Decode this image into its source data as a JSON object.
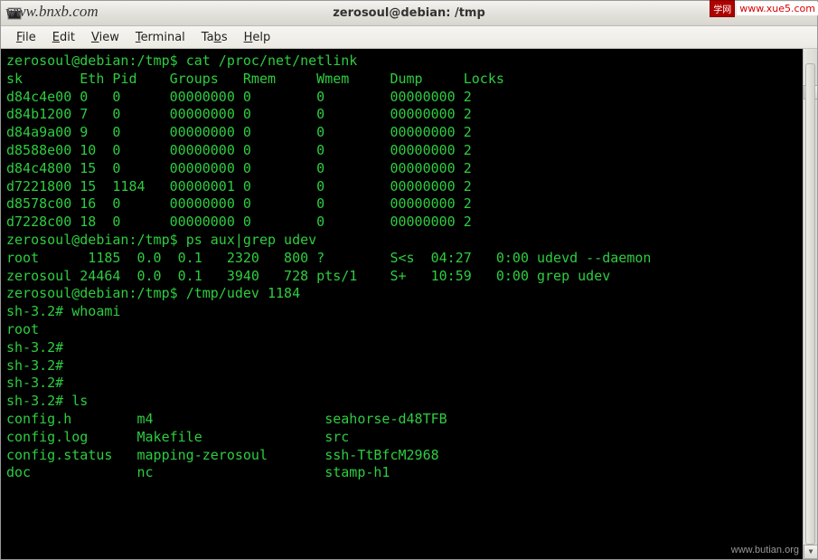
{
  "watermarks": {
    "top_left": "www.bnxb.com",
    "top_right_badge": "学网",
    "top_right_text": "www.xue5.com",
    "bottom_right": "www.butian.org"
  },
  "window": {
    "title": "zerosoul@debian: /tmp"
  },
  "menubar": {
    "file": "File",
    "edit": "Edit",
    "view": "View",
    "terminal": "Terminal",
    "tabs": "Tabs",
    "help": "Help"
  },
  "terminal": {
    "prompt1": "zerosoul@debian:/tmp$ ",
    "cmd1": "cat /proc/net/netlink",
    "netlink_header": "sk       Eth Pid    Groups   Rmem     Wmem     Dump     Locks",
    "netlink_rows": [
      "d84c4e00 0   0      00000000 0        0        00000000 2",
      "d84b1200 7   0      00000000 0        0        00000000 2",
      "d84a9a00 9   0      00000000 0        0        00000000 2",
      "d8588e00 10  0      00000000 0        0        00000000 2",
      "d84c4800 15  0      00000000 0        0        00000000 2",
      "d7221800 15  1184   00000001 0        0        00000000 2",
      "d8578c00 16  0      00000000 0        0        00000000 2",
      "d7228c00 18  0      00000000 0        0        00000000 2"
    ],
    "prompt2": "zerosoul@debian:/tmp$ ",
    "cmd2": "ps aux|grep udev",
    "ps_rows": [
      "root      1185  0.0  0.1   2320   800 ?        S<s  04:27   0:00 udevd --daemon",
      "zerosoul 24464  0.0  0.1   3940   728 pts/1    S+   10:59   0:00 grep udev"
    ],
    "prompt3": "zerosoul@debian:/tmp$ ",
    "cmd3": "/tmp/udev 1184",
    "sh_lines": [
      "sh-3.2# whoami",
      "root",
      "sh-3.2#",
      "sh-3.2#",
      "sh-3.2#",
      "sh-3.2# ls"
    ],
    "ls_rows": [
      "config.h        m4                     seahorse-d48TFB",
      "config.log      Makefile               src",
      "config.status   mapping-zerosoul       ssh-TtBfcM2968",
      "doc             nc                     stamp-h1"
    ]
  }
}
